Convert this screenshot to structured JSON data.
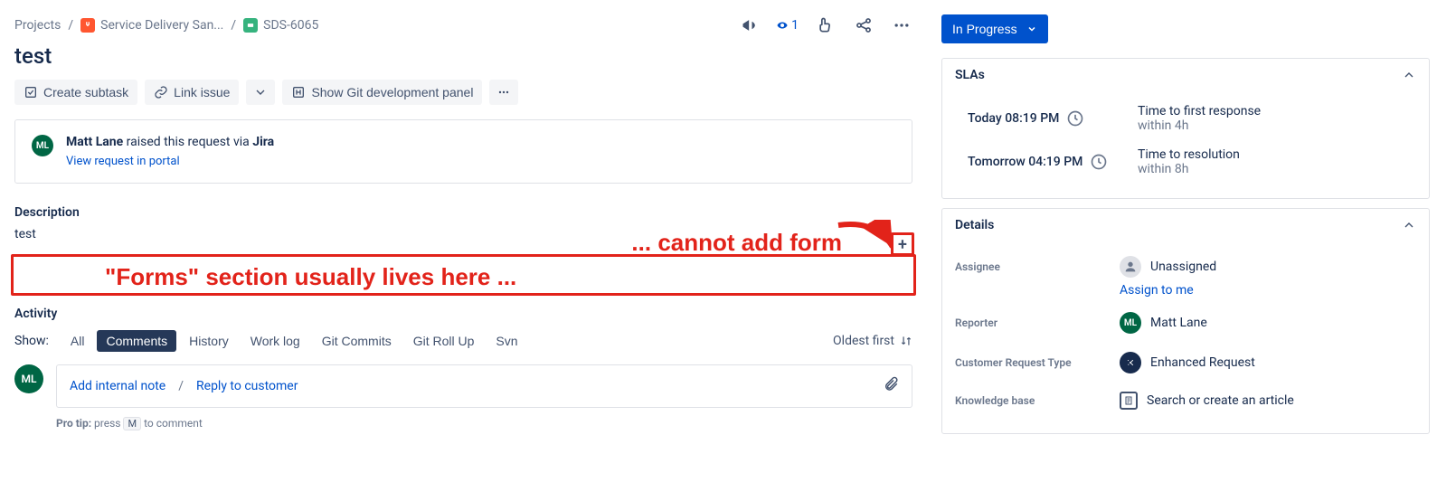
{
  "breadcrumbs": {
    "root": "Projects",
    "project": "Service Delivery San...",
    "issue": "SDS-6065"
  },
  "header": {
    "watch_count": "1"
  },
  "issue": {
    "title": "test",
    "description_label": "Description",
    "description_value": "test"
  },
  "actions": {
    "create_subtask": "Create subtask",
    "link_issue": "Link issue",
    "git_panel": "Show Git development panel"
  },
  "notice": {
    "initials": "ML",
    "actor": "Matt Lane",
    "phrase": " raised this request via ",
    "source": "Jira",
    "portal_link": "View request in portal"
  },
  "annotation": {
    "text1": "\"Forms\" section usually lives here ...",
    "text2": "... cannot add form"
  },
  "activity": {
    "heading": "Activity",
    "show_label": "Show:",
    "tabs": [
      "All",
      "Comments",
      "History",
      "Work log",
      "Git Commits",
      "Git Roll Up",
      "Svn"
    ],
    "active_tab": "Comments",
    "sort_label": "Oldest first",
    "user_initials": "ML",
    "add_internal": "Add internal note",
    "reply_customer": "Reply to customer",
    "protip_strong": "Pro tip:",
    "protip_before": " press ",
    "protip_key": "M",
    "protip_after": " to comment"
  },
  "side": {
    "status": "In Progress",
    "slas": {
      "title": "SLAs",
      "entries": [
        {
          "time": "Today 08:19 PM",
          "label": "Time to first response",
          "within": "within 4h"
        },
        {
          "time": "Tomorrow 04:19 PM",
          "label": "Time to resolution",
          "within": "within 8h"
        }
      ]
    },
    "details": {
      "title": "Details",
      "assignee_label": "Assignee",
      "assignee_value": "Unassigned",
      "assign_to_me": "Assign to me",
      "reporter_label": "Reporter",
      "reporter_value": "Matt Lane",
      "reporter_initials": "ML",
      "crt_label": "Customer Request Type",
      "crt_value": "Enhanced Request",
      "kb_label": "Knowledge base",
      "kb_value": "Search or create an article"
    }
  }
}
